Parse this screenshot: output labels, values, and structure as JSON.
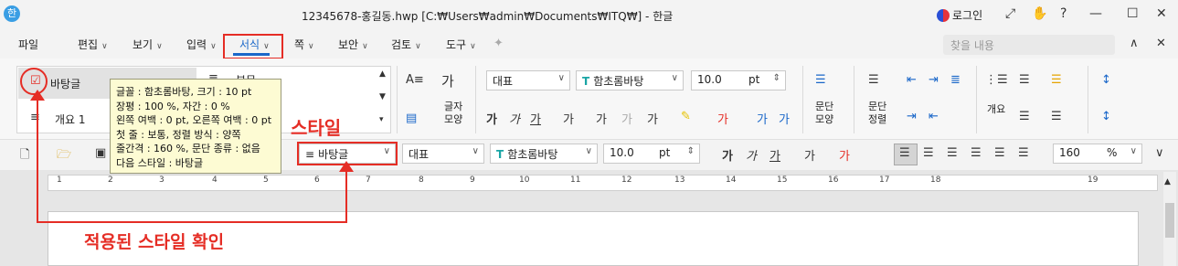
{
  "window": {
    "app_icon": "hwp-icon",
    "title": "12345678-홍길동.hwp [C:₩Users₩admin₩Documents₩ITQ₩] - 한글",
    "login": "로그인"
  },
  "menu": {
    "file": "파일",
    "edit": "편집",
    "view": "보기",
    "input": "입력",
    "format": "서식",
    "page": "쪽",
    "security": "보안",
    "review": "검토",
    "tools": "도구",
    "find_placeholder": "찾을 내용"
  },
  "ribbon": {
    "style_list": [
      {
        "label": "바탕글",
        "selected": true
      },
      {
        "label": "본문"
      },
      {
        "label": "개요 1"
      }
    ],
    "char_shape": "글자\n모양",
    "para_shape": "문단\n모양",
    "para_order": "문단\n정렬",
    "outline": "개요",
    "font_lang": "대표",
    "font_name": "함초롬바탕",
    "font_size": "10.0",
    "font_unit": "pt"
  },
  "toolbar2": {
    "style_value": "바탕글",
    "font_lang": "대표",
    "font_name": "함초롬바탕",
    "font_size": "10.0",
    "font_unit": "pt",
    "zoom": "160",
    "zoom_unit": "%"
  },
  "tooltip": {
    "line1": "글꼴 : 함초롬바탕,  크기 : 10 pt",
    "line2": "장평 : 100 %,  자간 : 0 %",
    "line3": "왼쪽 여백 : 0 pt,  오른쪽 여백 : 0 pt",
    "line4": "첫 줄 : 보통,  정렬 방식 : 양쪽",
    "line5": "줄간격 : 160 %,  문단 종류 : 없음",
    "line6": "다음 스타일 : 바탕글"
  },
  "ruler": {
    "numbers": [
      "1",
      "2",
      "3",
      "4",
      "5",
      "6",
      "7",
      "8",
      "9",
      "10",
      "11",
      "12",
      "13",
      "14",
      "15",
      "16",
      "17",
      "18",
      "19"
    ]
  },
  "annotations": {
    "style_label": "스타일",
    "check_label": "적용된 스타일 확인"
  },
  "colors": {
    "accent": "#1a67c9",
    "annotation": "#e52d25",
    "tooltip_bg": "#fdfbd3"
  }
}
